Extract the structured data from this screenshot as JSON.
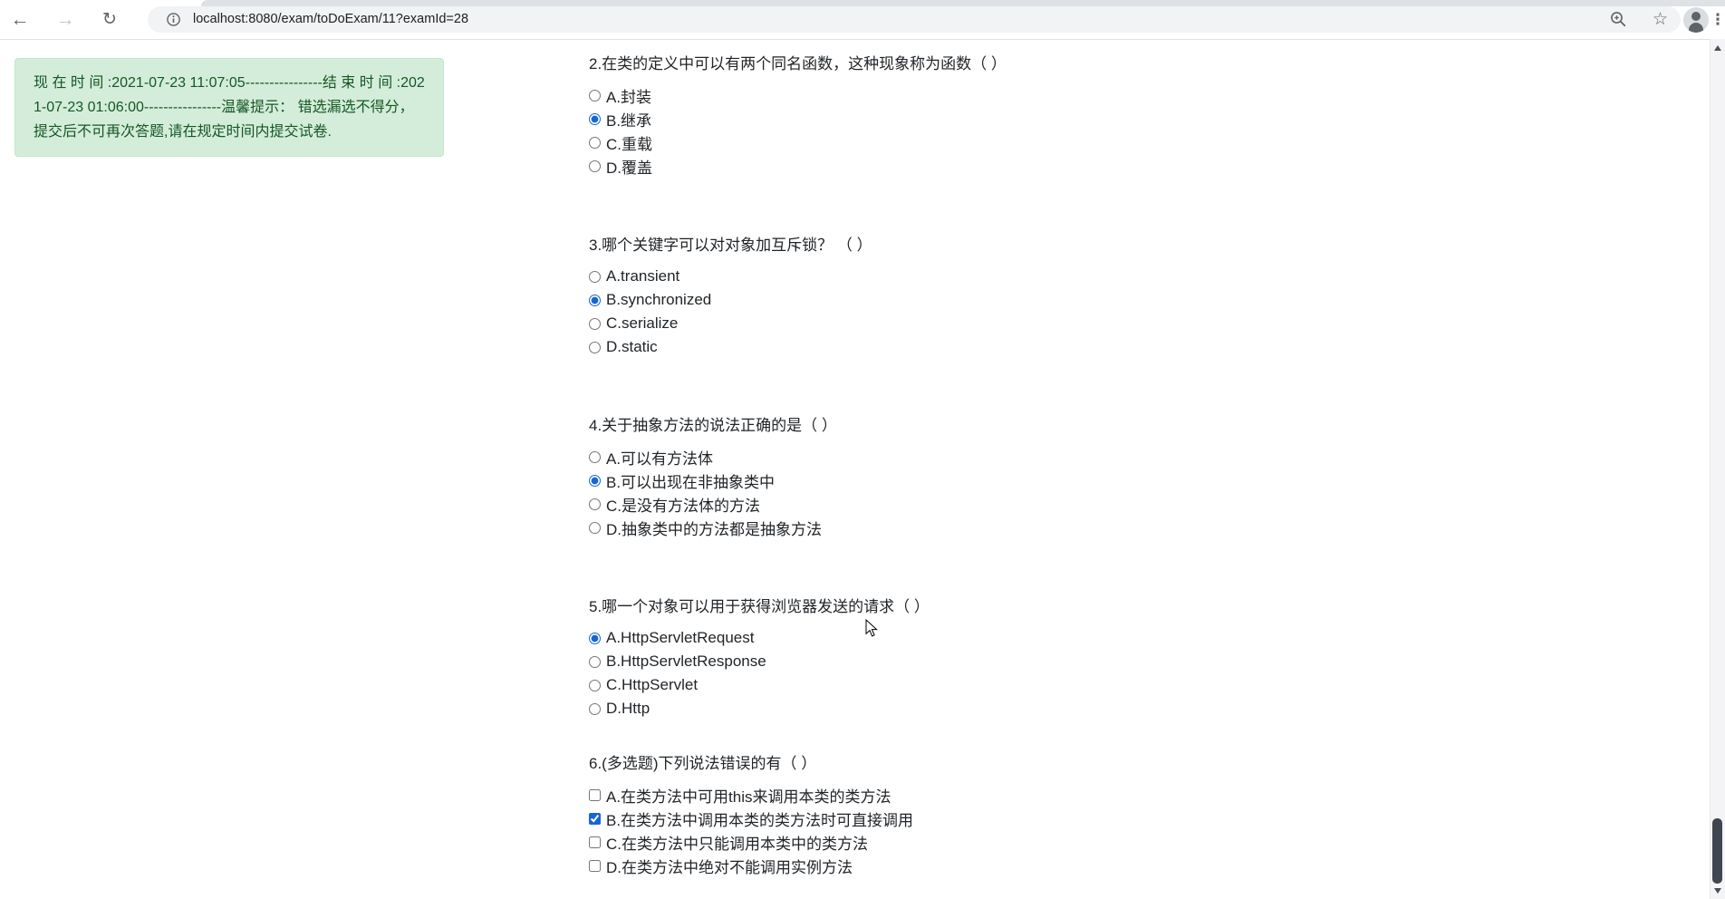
{
  "browser": {
    "url": "localhost:8080/exam/toDoExam/11?examId=28",
    "icons": {
      "back": "←",
      "forward": "→",
      "reload": "↻",
      "star": "☆",
      "menu": "⋮"
    }
  },
  "notice": {
    "text": "现 在 时 间 :2021-07-23 11:07:05----------------结 束 时 间 :2021-07-23 01:06:00----------------温馨提示： 错选漏选不得分， 提交后不可再次答题,请在规定时间内提交试卷."
  },
  "exam": {
    "questions": [
      {
        "title": "2.在类的定义中可以有两个同名函数，这种现象称为函数（ ）",
        "type": "radio",
        "options": [
          {
            "label": "A.封装",
            "selected": false
          },
          {
            "label": "B.继承",
            "selected": true
          },
          {
            "label": "C.重载",
            "selected": false
          },
          {
            "label": "D.覆盖",
            "selected": false
          }
        ]
      },
      {
        "title": "3.哪个关键字可以对对象加互斥锁？ （ ）",
        "type": "radio",
        "options": [
          {
            "label": "A.transient",
            "selected": false
          },
          {
            "label": "B.synchronized",
            "selected": true
          },
          {
            "label": "C.serialize",
            "selected": false
          },
          {
            "label": "D.static",
            "selected": false
          }
        ]
      },
      {
        "title": "4.关于抽象方法的说法正确的是（ ）",
        "type": "radio",
        "options": [
          {
            "label": "A.可以有方法体",
            "selected": false
          },
          {
            "label": "B.可以出现在非抽象类中",
            "selected": true
          },
          {
            "label": "C.是没有方法体的方法",
            "selected": false
          },
          {
            "label": "D.抽象类中的方法都是抽象方法",
            "selected": false
          }
        ]
      },
      {
        "title": "5.哪一个对象可以用于获得浏览器发送的请求（ ）",
        "type": "radio",
        "options": [
          {
            "label": "A.HttpServletRequest",
            "selected": true
          },
          {
            "label": "B.HttpServletResponse",
            "selected": false
          },
          {
            "label": "C.HttpServlet",
            "selected": false
          },
          {
            "label": "D.Http",
            "selected": false
          }
        ]
      },
      {
        "title": "6.(多选题)下列说法错误的有（ ）",
        "type": "checkbox",
        "options": [
          {
            "label": "A.在类方法中可用this来调用本类的类方法",
            "selected": false
          },
          {
            "label": "B.在类方法中调用本类的类方法时可直接调用",
            "selected": true
          },
          {
            "label": "C.在类方法中只能调用本类中的类方法",
            "selected": false
          },
          {
            "label": "D.在类方法中绝对不能调用实例方法",
            "selected": false
          }
        ]
      }
    ]
  },
  "colors": {
    "accent": "#1566d4",
    "notice_bg": "#d4edda",
    "notice_border": "#c3e6cb",
    "notice_text": "#155724",
    "chrome_border": "#dfe1e5",
    "tabstrip": "#dee1e6",
    "omnibox_bg": "#f1f3f4",
    "icon_gray": "#5f6368",
    "icon_disabled": "#c1c5ca",
    "scroll_track": "#f4f4f6",
    "scroll_thumb": "#40464f"
  }
}
